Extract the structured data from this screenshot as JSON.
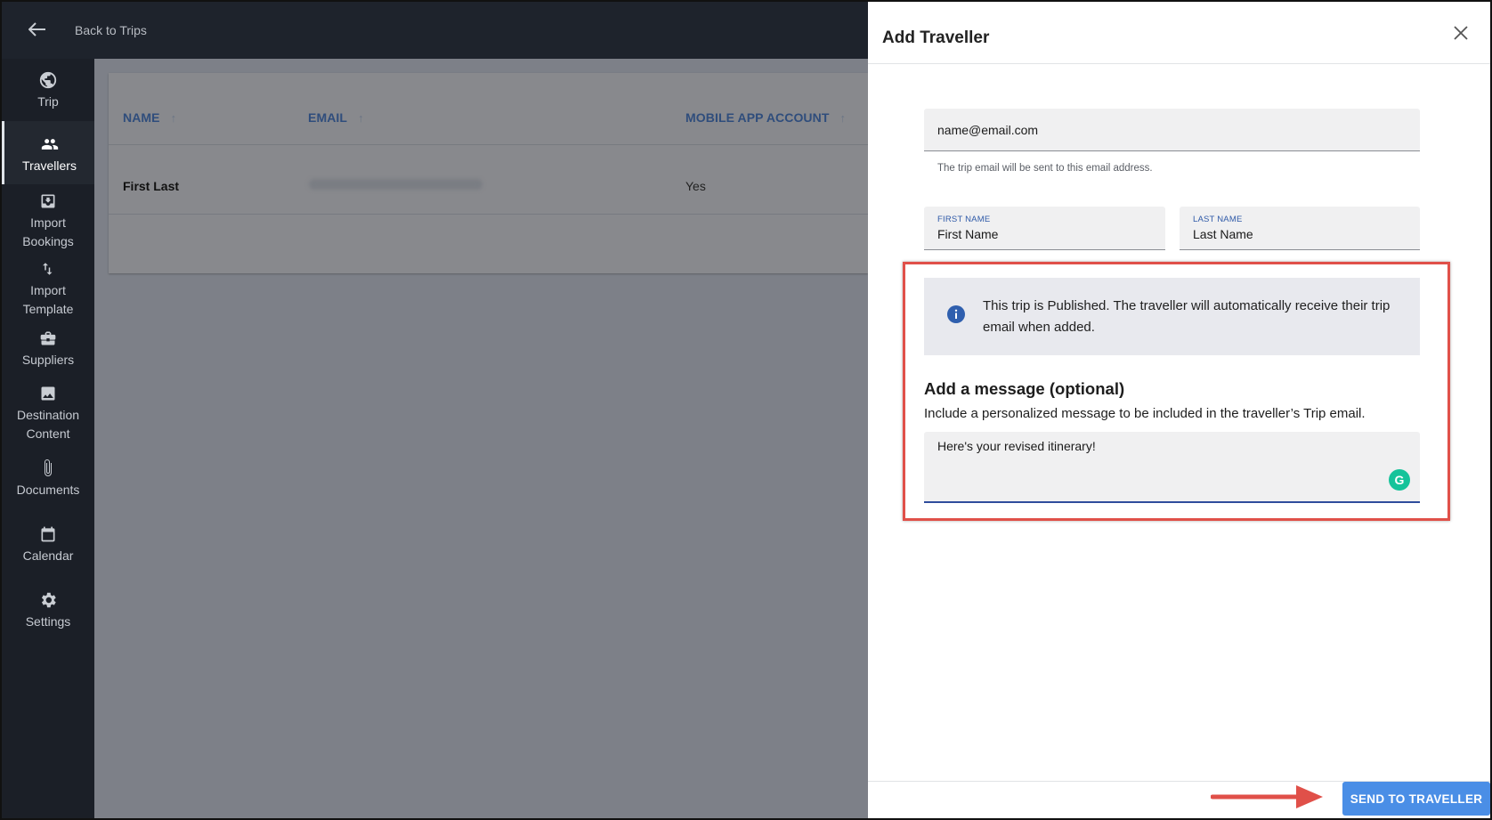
{
  "topbar": {
    "back_label": "Back to Trips"
  },
  "sidebar": {
    "items": [
      {
        "label": "Trip",
        "icon": "globe-icon"
      },
      {
        "label": "Travellers",
        "icon": "people-icon",
        "active": true
      },
      {
        "label": "Import\nBookings",
        "icon": "download-box-icon"
      },
      {
        "label": "Import\nTemplate",
        "icon": "swap-vertical-icon"
      },
      {
        "label": "Suppliers",
        "icon": "briefcase-icon"
      },
      {
        "label": "Destination\nContent",
        "icon": "image-icon"
      },
      {
        "label": "Documents",
        "icon": "paperclip-icon"
      },
      {
        "label": "Calendar",
        "icon": "calendar-icon"
      },
      {
        "label": "Settings",
        "icon": "gear-icon"
      }
    ]
  },
  "table": {
    "headers": [
      "NAME",
      "EMAIL",
      "MOBILE APP ACCOUNT"
    ],
    "rows": [
      {
        "name": "First Last",
        "email": "",
        "mobile_app_account": "Yes"
      }
    ]
  },
  "drawer": {
    "title": "Add Traveller",
    "email_value": "name@email.com",
    "email_helper": "The trip email will be sent to this email address.",
    "first_name_label": "FIRST NAME",
    "first_name_value": "First Name",
    "last_name_label": "LAST NAME",
    "last_name_value": "Last Name",
    "info_text": "This trip is Published. The traveller will automatically receive their trip email when added.",
    "message_heading": "Add a message (optional)",
    "message_sub": "Include a personalized message to be included in the traveller’s Trip email.",
    "message_value": "Here's your revised itinerary!",
    "send_label": "SEND TO TRAVELLER"
  },
  "colors": {
    "accent": "#4a8ee6",
    "highlight": "#e05049",
    "header_text": "#2f4d7c",
    "sidebar_bg": "#1b1f27"
  }
}
